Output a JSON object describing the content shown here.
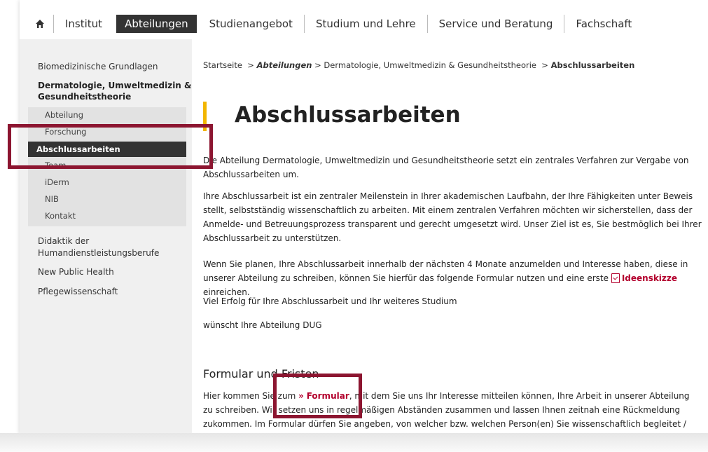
{
  "topnav": {
    "home_icon": "home-icon",
    "items": [
      "Institut",
      "Abteilungen",
      "Studienangebot",
      "Studium und Lehre",
      "Service und Beratung",
      "Fachschaft"
    ]
  },
  "sidebar": {
    "item0": "Biomedizinische Grundlagen",
    "head_line1": "Dermatologie, Umweltmedizin &",
    "head_line2": "Gesundheitstheorie",
    "sub": [
      "Abteilung",
      "Forschung",
      "Abschlussarbeiten",
      "Team",
      "iDerm",
      "NIB",
      "Kontakt"
    ],
    "item_didaktik_1": "Didaktik der",
    "item_didaktik_2": "Humandienstleistungsberufe",
    "item_nph": "New Public Health",
    "item_pflege": "Pflegewissenschaft"
  },
  "breadcrumb": {
    "home": "Startseite",
    "sep": ">",
    "abteilungen": "Abteilungen",
    "dept": "Dermatologie, Umweltmedizin & Gesundheitstheorie",
    "current": "Abschlussarbeiten"
  },
  "main": {
    "title": "Abschlussarbeiten",
    "p1": "Die Abteilung Dermatologie, Umweltmedizin und Gesundheitstheorie setzt ein zentrales Verfahren zur Vergabe von Abschlussarbeiten um.",
    "p2": "Ihre Abschlussarbeit ist ein zentraler Meilenstein in Ihrer akademischen Laufbahn, der Ihre Fähigkeiten unter Beweis stellt, selbstständig wissenschaftlich zu arbeiten. Mit einem zentralen Verfahren möchten wir sicherstellen, dass der Anmelde- und Betreuungsprozess transparent und gerecht umgesetzt wird. Unser Ziel ist es, Sie bestmöglich bei Ihrer Abschlussarbeit zu unterstützen.",
    "p3_before": "Wenn Sie planen, Ihre Abschlussarbeit innerhalb der nächsten 4 Monate anzumelden und Interesse haben, diese in unserer Abteilung zu schreiben, können Sie hierfür das folgende Formular nutzen und eine erste ",
    "p3_link": "Ideenskizze",
    "p3_after": " einreichen.",
    "p4": "Viel Erfolg für Ihre Abschlussarbeit und Ihr weiteres Studium",
    "p5": "wünscht Ihre Abteilung DUG",
    "h2": "Formular und Fristen",
    "p6_before": "Hier kommen Sie zum ",
    "p6_chev": "»",
    "p6_link": "Formular",
    "p6_after": ", mit dem Sie uns Ihr Interesse mitteilen können, Ihre Arbeit in unserer Abteilung zu schreiben. Wir setzen uns in regelmäßigen Abständen zusammen und lassen Ihnen zeitnah eine Rückmeldung zukommen. Im Formular dürfen Sie angeben, von welcher bzw. welchen Person(en) Sie wissenschaftlich begleitet / betreut werden möchten."
  },
  "colors": {
    "accent": "#b3002d",
    "highlight": "#8c1530",
    "title_bar": "#f2b600",
    "active_bg": "#333333"
  }
}
